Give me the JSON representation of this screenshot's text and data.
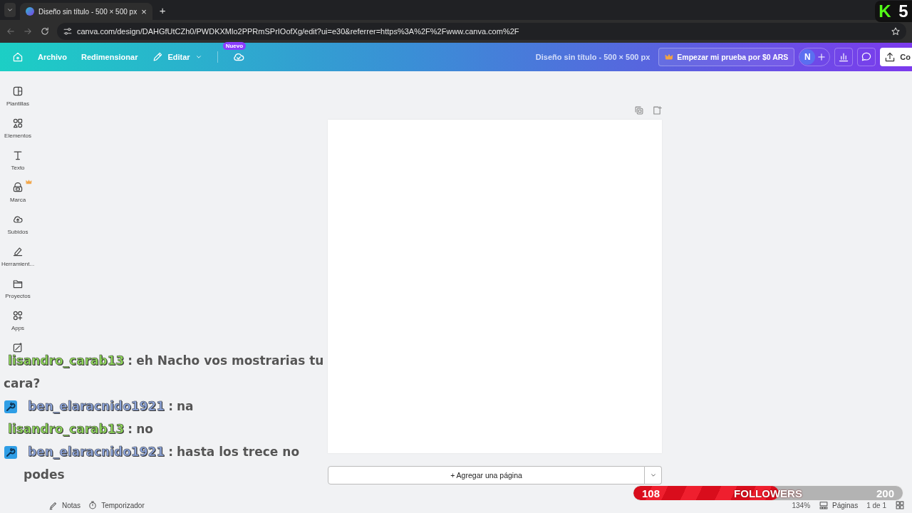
{
  "browser": {
    "tab": {
      "title": "Diseño sin título - 500 × 500 px",
      "close": "×"
    },
    "new_tab": "+",
    "url": "canva.com/design/DAHGfUtCZh0/PWDKXMlo2PPRmSPrIOofXg/edit?ui=e30&referrer=https%3A%2F%2Fwww.canva.com%2F"
  },
  "header": {
    "menu": [
      "Archivo",
      "Redimensionar"
    ],
    "edit": "Editar",
    "badge": "Nuevo",
    "title": "Diseño sin título - 500 × 500 px",
    "trial_button": "Empezar mi prueba por $0 ARS",
    "avatar": "N",
    "share_button": "Co"
  },
  "sidebar": {
    "items": [
      {
        "label": "Plantillas",
        "crown": false
      },
      {
        "label": "Elementos",
        "crown": false
      },
      {
        "label": "Texto",
        "crown": false
      },
      {
        "label": "Marca",
        "crown": true
      },
      {
        "label": "Subidos",
        "crown": false
      },
      {
        "label": "Herramient...",
        "crown": false
      },
      {
        "label": "Proyectos",
        "crown": false
      },
      {
        "label": "Apps",
        "crown": false
      },
      {
        "crown": false
      }
    ]
  },
  "editor": {
    "add_page": "+ Agregar una página"
  },
  "footer": {
    "left": [
      "Notas",
      "Temporizador"
    ],
    "zoom": "134%",
    "pages": "Páginas",
    "page_count": "1 de 1"
  },
  "chat": [
    {
      "user": "lisandro_carab13",
      "color": "#8fd85a",
      "badge": false,
      "text": "eh Nacho vos mostrarias tu cara?"
    },
    {
      "user": "ben_elaracnido1921",
      "color": "#8ea6dc",
      "badge": true,
      "text": "na"
    },
    {
      "user": "lisandro_carab13",
      "color": "#8fd85a",
      "badge": false,
      "text": "no"
    },
    {
      "user": "ben_elaracnido1921",
      "color": "#8ea6dc",
      "badge": true,
      "text": "hasta los trece no podes"
    }
  ],
  "separator": ":",
  "followers": {
    "current": "108",
    "label": "FOLLOWERS",
    "goal": "200",
    "level": 0.54
  },
  "stream_badge": {
    "logo": "K",
    "count": "5"
  }
}
